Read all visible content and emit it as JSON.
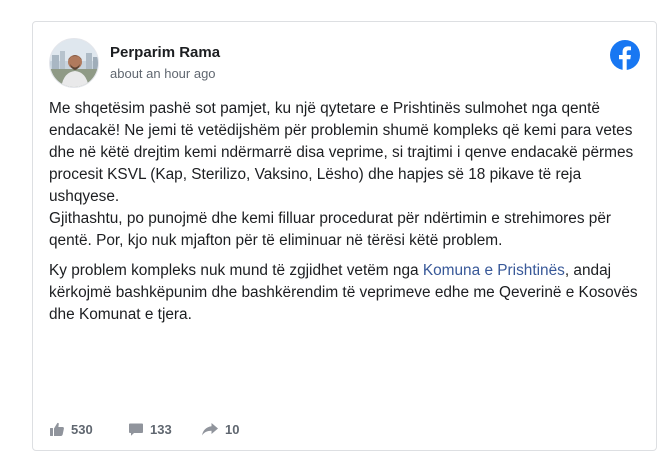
{
  "post": {
    "author": "Perparim Rama",
    "timestamp": "about an hour ago",
    "paragraph1": "Me shqetësim pashë sot pamjet, ku një qytetare e Prishtinës sulmohet nga qentë endacakë! Ne jemi të vetëdijshëm për problemin shumë kompleks që kemi para vetes dhe në këtë drejtim kemi ndërmarrë disa veprime, si trajtimi i qenve endacakë përmes procesit KSVL (Kap, Sterilizo, Vaksino, Lësho) dhe hapjes së 18 pikave të reja ushqyese.",
    "paragraph2": "Gjithashtu, po punojmë dhe kemi filluar procedurat për ndërtimin e strehimores për qentë. Por, kjo nuk mjafton për të eliminuar në tërësi këtë problem.",
    "paragraph3_before": "Ky problem kompleks nuk mund të zgjidhet vetëm nga ",
    "paragraph3_link": "Komuna e Prishtinës",
    "paragraph3_after": ", andaj kërkojmë bashkëpunim dhe bashkërendim të veprimeve edhe me Qeverinë e Kosovës dhe Komunat e tjera."
  },
  "stats": {
    "likes": "530",
    "comments": "133",
    "shares": "10"
  },
  "icons": {
    "platform": "facebook-icon",
    "likes": "thumbs-up-icon",
    "comments": "comment-icon",
    "shares": "share-arrow-icon"
  },
  "colors": {
    "facebook_blue": "#1877f2",
    "link": "#385898",
    "text": "#1c1e21",
    "secondary_text": "#606770",
    "icon_gray": "#90949c"
  }
}
